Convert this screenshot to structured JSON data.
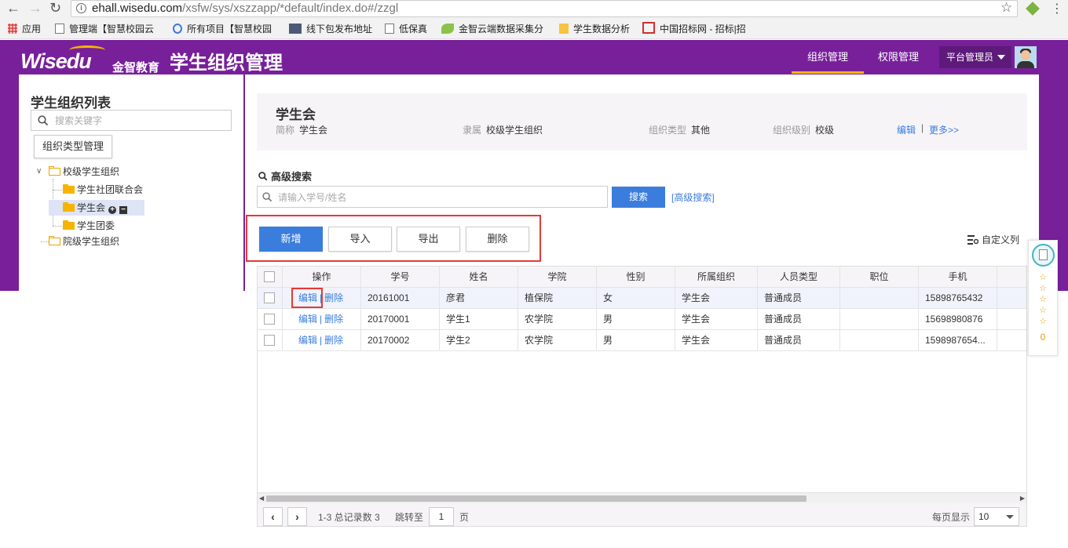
{
  "browser": {
    "url_host": "ehall.wisedu.com",
    "url_path": "/xsfw/sys/xszzapp/*default/index.do#/zzgl",
    "bookmarks": [
      {
        "label": "应用"
      },
      {
        "label": "管理端【智慧校园云"
      },
      {
        "label": "所有项目【智慧校园"
      },
      {
        "label": "线下包发布地址"
      },
      {
        "label": "低保真"
      },
      {
        "label": "金智云端数据采集分"
      },
      {
        "label": "学生数据分析"
      },
      {
        "label": "中国招标网 - 招标|招"
      }
    ]
  },
  "header": {
    "logo_text": "Wisedu",
    "logo_cn": "金智教育",
    "title": "学生组织管理",
    "nav": [
      {
        "label": "组织管理",
        "active": true
      },
      {
        "label": "权限管理",
        "active": false
      }
    ],
    "role": "平台管理员"
  },
  "sidebar": {
    "title": "学生组织列表",
    "search_placeholder": "搜索关键字",
    "type_button": "组织类型管理",
    "tree": [
      {
        "label": "校级学生组织"
      },
      {
        "label": "学生社团联合会"
      },
      {
        "label": "学生会"
      },
      {
        "label": "学生团委"
      },
      {
        "label": "院级学生组织"
      }
    ]
  },
  "card": {
    "name": "学生会",
    "fields": [
      {
        "key": "简称",
        "value": "学生会"
      },
      {
        "key": "隶属",
        "value": "校级学生组织"
      },
      {
        "key": "组织类型",
        "value": "其他"
      },
      {
        "key": "组织级别",
        "value": "校级"
      }
    ],
    "edit": "编辑",
    "sep": "|",
    "more": "更多>>"
  },
  "search": {
    "title": "高级搜索",
    "placeholder": "请输入学号/姓名",
    "button": "搜索",
    "advanced_link": "[高级搜索]"
  },
  "toolbar": {
    "add": "新增",
    "import": "导入",
    "export": "导出",
    "delete": "删除",
    "custom_columns": "自定义列"
  },
  "table": {
    "headers": [
      "操作",
      "学号",
      "姓名",
      "学院",
      "性别",
      "所属组织",
      "人员类型",
      "职位",
      "手机",
      "电"
    ],
    "edit_label": "编辑",
    "delete_label": "删除",
    "sep": "|",
    "rows": [
      {
        "id": "20161001",
        "name": "彦君",
        "college": "植保院",
        "gender": "女",
        "org": "学生会",
        "type": "普通成员",
        "position": "",
        "phone": "15898765432"
      },
      {
        "id": "20170001",
        "name": "学生1",
        "college": "农学院",
        "gender": "男",
        "org": "学生会",
        "type": "普通成员",
        "position": "",
        "phone": "15698980876"
      },
      {
        "id": "20170002",
        "name": "学生2",
        "college": "农学院",
        "gender": "男",
        "org": "学生会",
        "type": "普通成员",
        "position": "",
        "phone": "1598987654..."
      }
    ]
  },
  "pager": {
    "summary": "1-3 总记录数 3",
    "jump_label": "跳转至",
    "page": "1",
    "page_unit": "页",
    "per_page_label": "每页显示",
    "per_page": "10"
  },
  "float_widget": {
    "stars": [
      "☆",
      "☆",
      "☆",
      "☆",
      "☆"
    ],
    "score": "0"
  },
  "colors": {
    "brand_purple": "#77209a",
    "accent_blue": "#3b7ddd",
    "highlight_red": "#e53935",
    "nav_underline": "#f7b500"
  }
}
